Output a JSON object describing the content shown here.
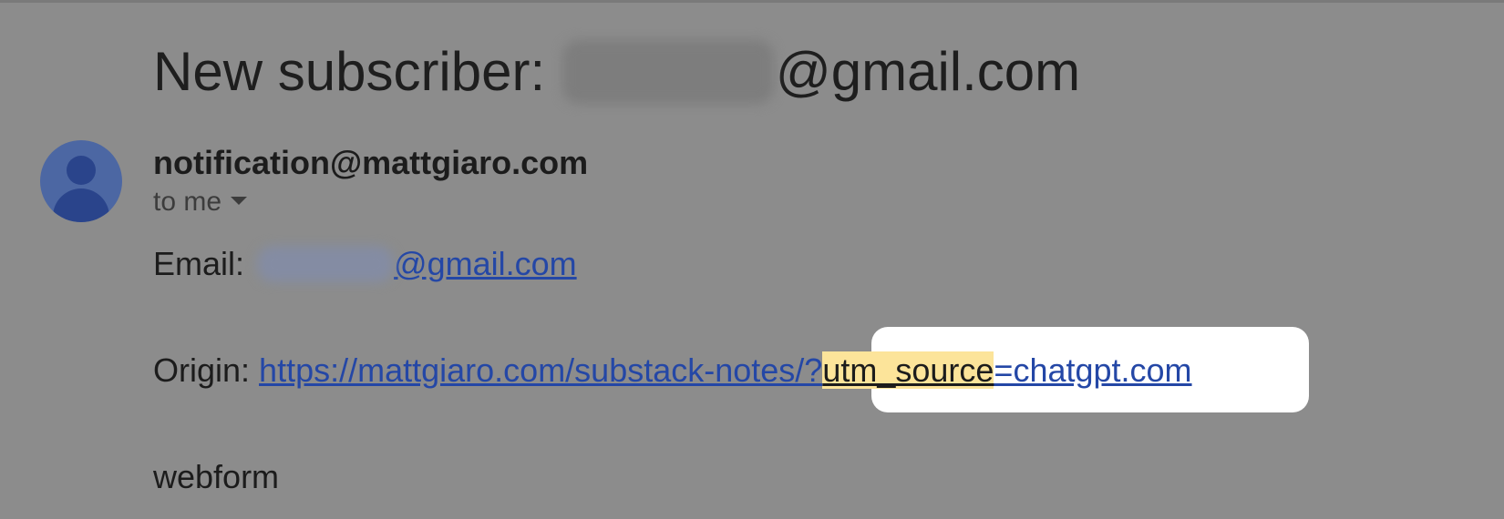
{
  "email": {
    "subject_prefix": "New subscriber: ",
    "subject_suffix": "@gmail.com",
    "sender": "notification@mattgiaro.com",
    "recipient": "to me",
    "body": {
      "email_label": "Email: ",
      "email_link_suffix": "@gmail.com",
      "origin_label": "Origin: ",
      "origin_url_prefix": "https://mattgiaro.com/substack-notes/?",
      "origin_url_param": "utm_source",
      "origin_url_value": "=chatgpt.com",
      "webform_text": "webform"
    }
  },
  "colors": {
    "background_dim": "#8c8c8c",
    "link": "#2447a6",
    "avatar": "#4c67a3",
    "highlight": "#fce49a",
    "spotlight": "#ffffff"
  },
  "icons": {
    "avatar": "person-icon",
    "recipient_toggle": "caret-down-icon"
  }
}
